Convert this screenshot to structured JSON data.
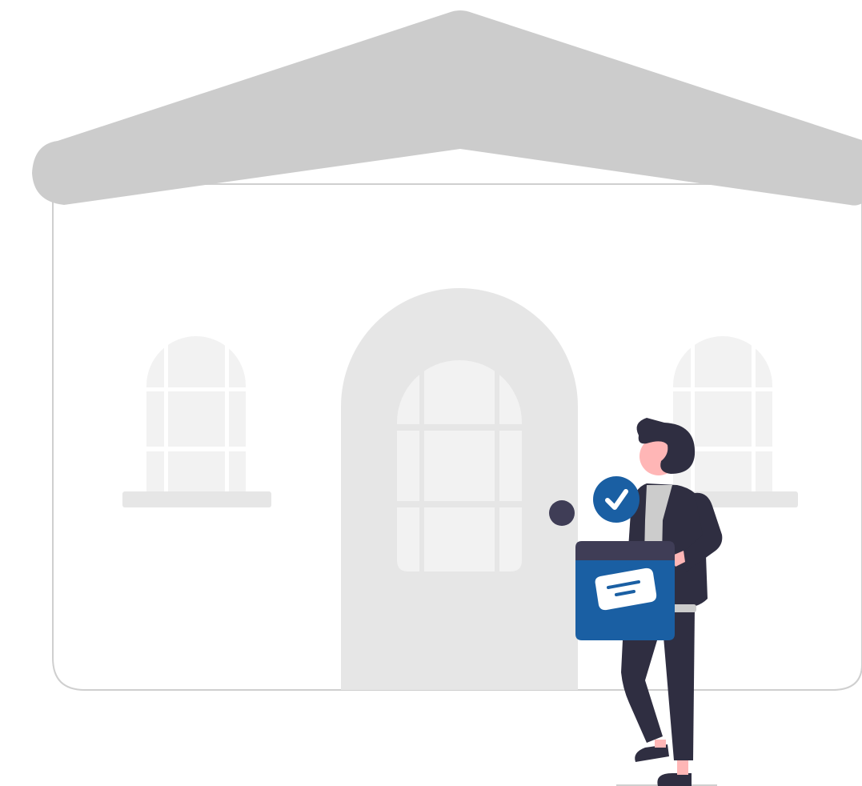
{
  "illustration": {
    "subject": "house",
    "colors": {
      "roof": "#cccccc",
      "wall_outline": "#cfcfcf",
      "wall_fill": "#ffffff",
      "door": "#e6e6e6",
      "window_pane": "#f2f2f2",
      "window_frame": "#ffffff",
      "sill": "#e6e6e6",
      "door_knob": "#3f3d56",
      "person_dark": "#2f2e41",
      "skin": "#ffb6b6",
      "shirt": "#cccccc",
      "box_blue": "#1a5fa3",
      "box_lid": "#3f3d56",
      "label": "#ffffff",
      "check_badge": "#1a5fa3",
      "check_mark": "#ffffff"
    },
    "icons": [
      "check-icon",
      "delivery-box-icon",
      "door-knob"
    ]
  }
}
